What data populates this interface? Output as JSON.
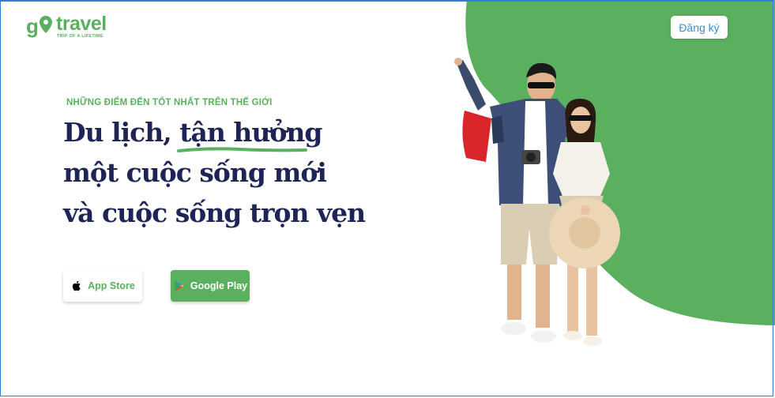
{
  "logo": {
    "word": "travel",
    "tagline": "TRIP OF A LIFETIME"
  },
  "header": {
    "register_label": "Đăng ký"
  },
  "hero": {
    "eyebrow": "NHỮNG ĐIỂM ĐẾN TỐT NHẤT TRÊN THẾ GIỚI",
    "headline": [
      "Du lịch, tận hưởng",
      "một cuộc sống mới",
      "và cuộc sống trọn vẹn"
    ]
  },
  "stores": {
    "app_store": "App Store",
    "google_play": "Google Play"
  },
  "colors": {
    "brand_green": "#5bb05f",
    "headline_navy": "#1f2456",
    "link_blue": "#3a8fd0"
  },
  "icons": {
    "apple": "apple-icon",
    "google_play": "google-play-icon",
    "logo_pin": "map-pin-icon"
  }
}
